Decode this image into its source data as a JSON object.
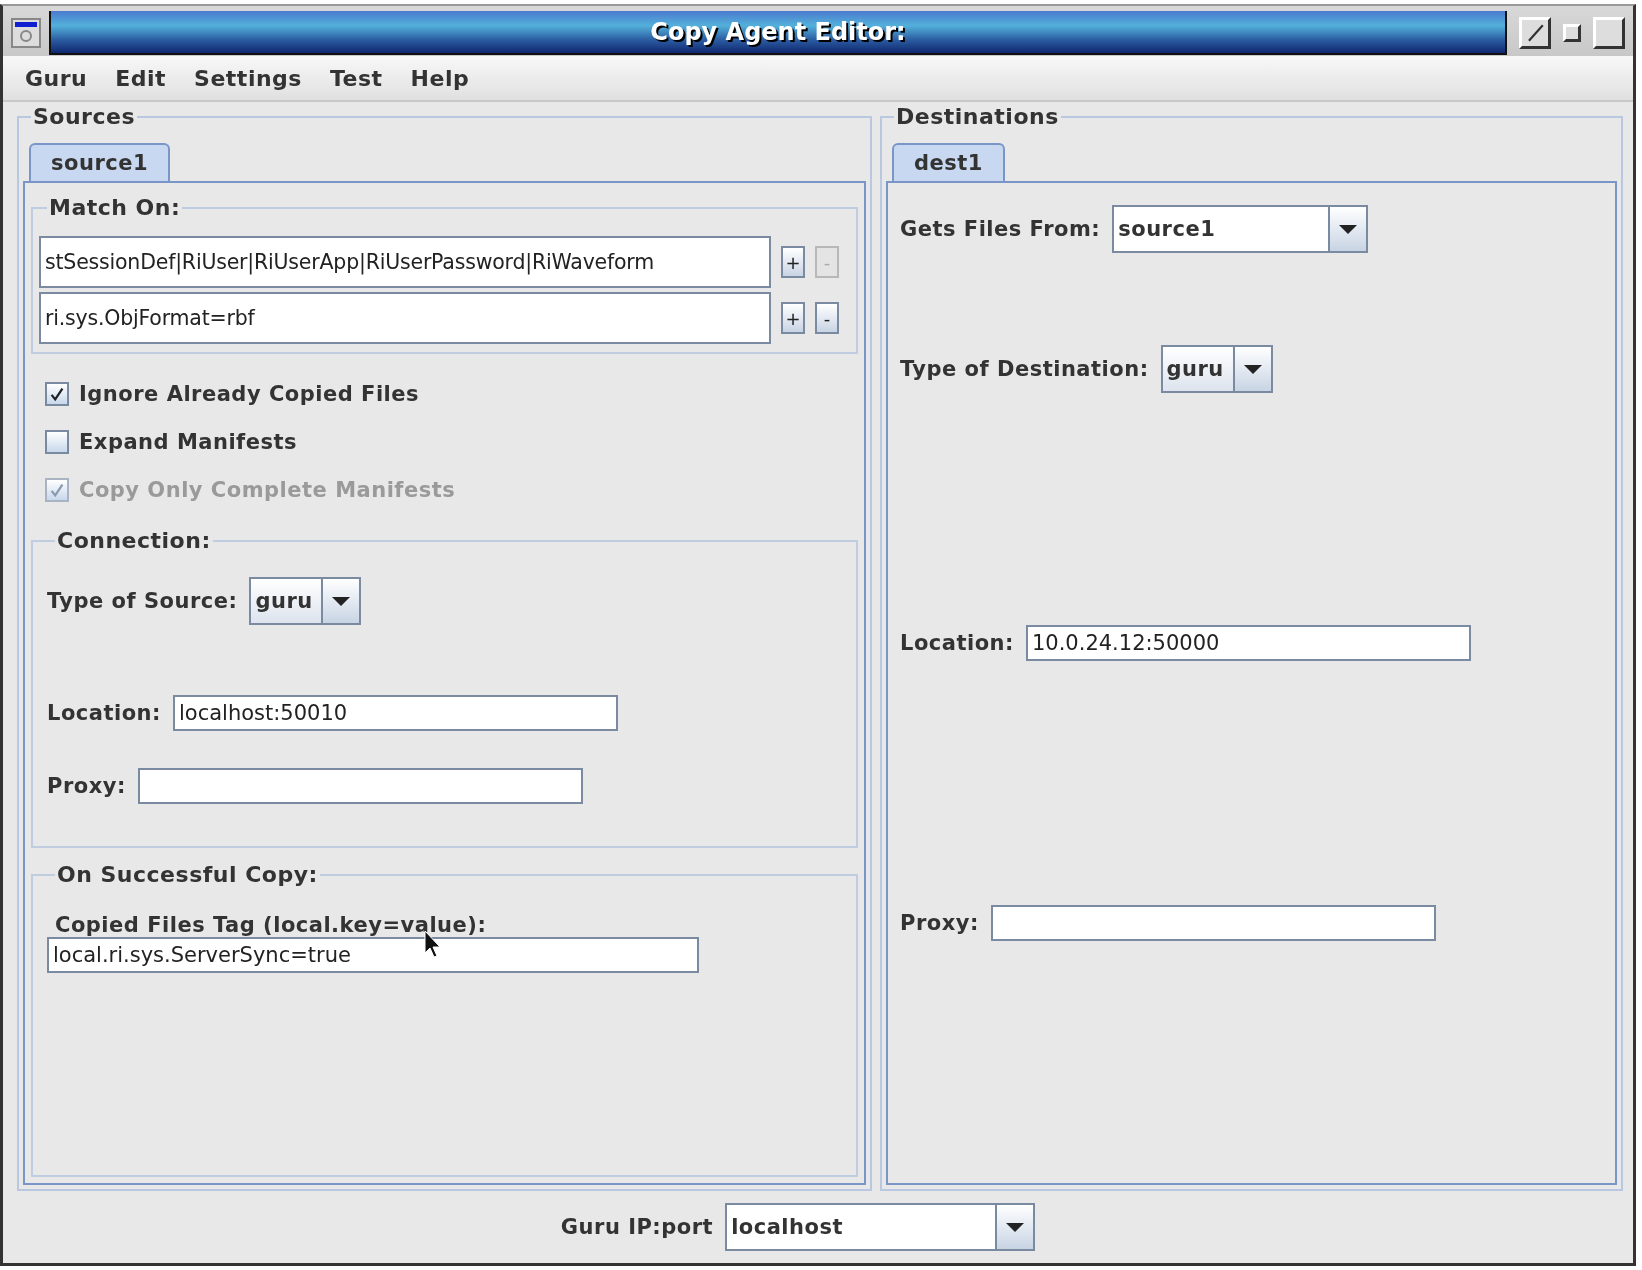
{
  "window": {
    "title": "Copy Agent Editor:"
  },
  "menu": [
    "Guru",
    "Edit",
    "Settings",
    "Test",
    "Help"
  ],
  "sources": {
    "title": "Sources",
    "tabs": [
      {
        "label": "source1",
        "selected": true
      }
    ],
    "match_on": {
      "title": "Match On:",
      "rows": [
        {
          "value": "stSessionDef|RiUser|RiUserApp|RiUserPassword|RiWaveform",
          "add": "+",
          "remove": "-",
          "remove_disabled": true
        },
        {
          "value": "ri.sys.ObjFormat=rbf",
          "add": "+",
          "remove": "-",
          "remove_disabled": false
        }
      ]
    },
    "options": [
      {
        "label": "Ignore Already Copied Files",
        "checked": true,
        "disabled": false
      },
      {
        "label": "Expand Manifests",
        "checked": false,
        "disabled": false
      },
      {
        "label": "Copy Only Complete Manifests",
        "checked": true,
        "disabled": true
      }
    ],
    "connection": {
      "title": "Connection:",
      "type_label": "Type of Source:",
      "type_value": "guru",
      "location_label": "Location:",
      "location_value": "localhost:50010",
      "proxy_label": "Proxy:"
    },
    "on_success": {
      "title": "On Successful Copy:",
      "tag_label": "Copied Files Tag (local.key=value):",
      "tag_value": "local.ri.sys.ServerSync=true"
    }
  },
  "destinations": {
    "title": "Destinations",
    "tabs": [
      {
        "label": "dest1",
        "selected": true
      }
    ],
    "gets_from_label": "Gets Files From:",
    "gets_from_value": "source1",
    "type_label": "Type of Destination:",
    "type_value": "guru",
    "location_label": "Location:",
    "location_value": "10.0.24.12:50000",
    "proxy_label": "Proxy:"
  },
  "footer": {
    "label": "Guru IP:port",
    "value": "localhost"
  }
}
